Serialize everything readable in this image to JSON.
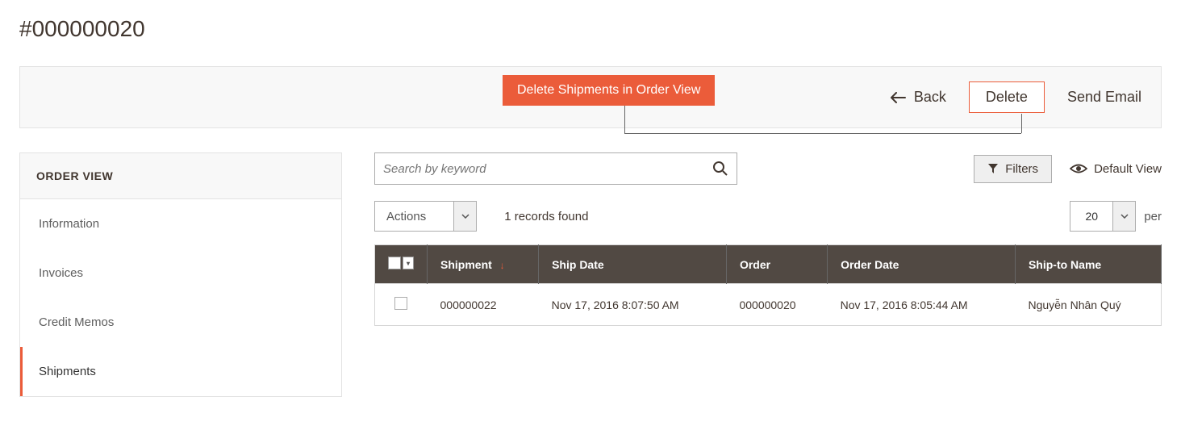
{
  "page": {
    "title": "#000000020"
  },
  "annotation": {
    "label": "Delete Shipments in Order View"
  },
  "actionbar": {
    "back": "Back",
    "delete": "Delete",
    "send_email": "Send Email"
  },
  "sidebar": {
    "title": "ORDER VIEW",
    "items": [
      {
        "label": "Information"
      },
      {
        "label": "Invoices"
      },
      {
        "label": "Credit Memos"
      },
      {
        "label": "Shipments"
      }
    ]
  },
  "toolbar": {
    "search_placeholder": "Search by keyword",
    "filters": "Filters",
    "default_view": "Default View",
    "actions": "Actions",
    "records_found": "1 records found",
    "page_size": "20",
    "per": "per"
  },
  "table": {
    "headers": {
      "shipment": "Shipment",
      "ship_date": "Ship Date",
      "order": "Order",
      "order_date": "Order Date",
      "ship_to_name": "Ship-to Name"
    },
    "rows": [
      {
        "shipment": "000000022",
        "ship_date": "Nov 17, 2016 8:07:50 AM",
        "order": "000000020",
        "order_date": "Nov 17, 2016 8:05:44 AM",
        "ship_to_name": "Nguyễn Nhân Quý"
      }
    ]
  }
}
